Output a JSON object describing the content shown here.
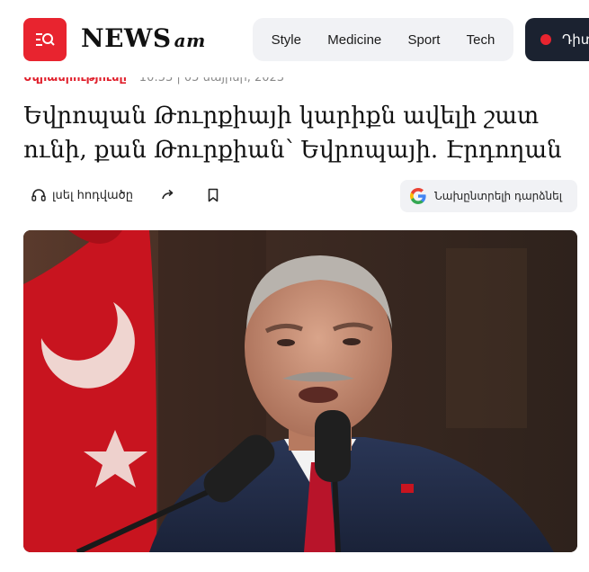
{
  "header": {
    "logo_main": "NEWS",
    "logo_suffix": "am",
    "nav": [
      "Style",
      "Medicine",
      "Sport",
      "Tech"
    ],
    "live_label": "Դիտ"
  },
  "article": {
    "category": "Եվրամիությունը",
    "date": "10:53 | 05 մայիսի, 2023",
    "title": "Եվրոպան Թուրքիայի կարիքն ավելի շատ ունի, քան Թուրքիան՝ Եվրոպայի. Էրդողան",
    "actions": {
      "listen_label": "լսել հոդվածը",
      "preferred_label": "Նախընտրելի դարձնել"
    }
  },
  "icons": {
    "logo": "news-search-icon",
    "listen": "headphones-icon",
    "share": "share-arrow-icon",
    "bookmark": "bookmark-icon",
    "google": "google-g-icon"
  },
  "colors": {
    "brand_red": "#e8242f",
    "dark_button": "#1b2230",
    "pill_bg": "#f1f2f5"
  }
}
